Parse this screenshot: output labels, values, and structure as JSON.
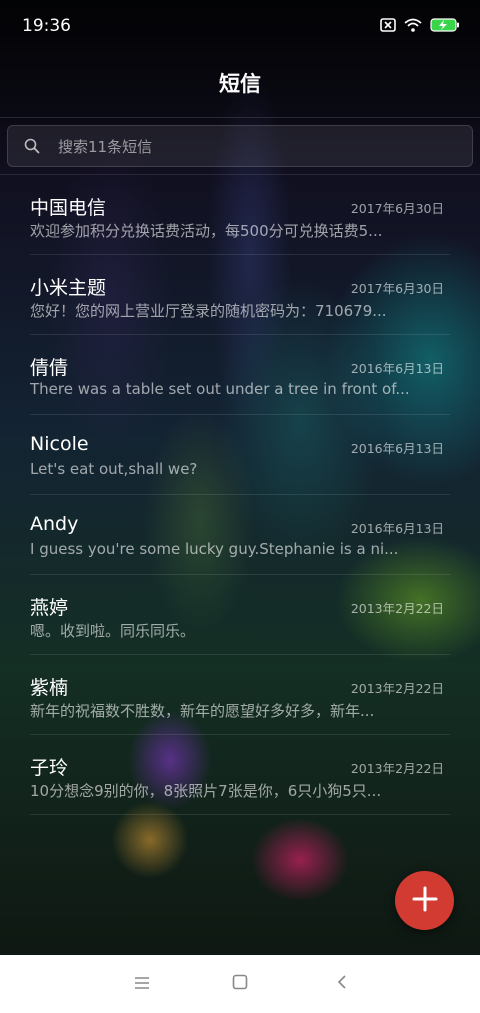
{
  "status": {
    "time": "19:36",
    "icons": [
      "sim-off-icon",
      "wifi-icon",
      "battery-charging-icon"
    ]
  },
  "header": {
    "title": "短信"
  },
  "search": {
    "placeholder": "搜索11条短信"
  },
  "conversations": [
    {
      "name": "中国电信",
      "date": "2017年6月30日",
      "preview": "欢迎参加积分兑换话费活动，每500分可兑换话费5..."
    },
    {
      "name": "小米主题",
      "date": "2017年6月30日",
      "preview": "您好！您的网上营业厅登录的随机密码为：710679..."
    },
    {
      "name": "倩倩",
      "date": "2016年6月13日",
      "preview": "There was a table set out under a tree in front of..."
    },
    {
      "name": "Nicole",
      "date": "2016年6月13日",
      "preview": "Let's eat out,shall we?"
    },
    {
      "name": "Andy",
      "date": "2016年6月13日",
      "preview": "I guess you're some lucky guy.Stephanie is a ni..."
    },
    {
      "name": "燕婷",
      "date": "2013年2月22日",
      "preview": "嗯。收到啦。同乐同乐。"
    },
    {
      "name": "紫楠",
      "date": "2013年2月22日",
      "preview": "新年的祝福数不胜数，新年的愿望好多好多，新年..."
    },
    {
      "name": "子玲",
      "date": "2013年2月22日",
      "preview": "10分想念9别的你，8张照片7张是你，6只小狗5只..."
    }
  ],
  "fab": {
    "icon": "plus-icon",
    "color": "#d23b32"
  },
  "navbar": {
    "buttons": [
      "menu-icon",
      "home-icon",
      "back-icon"
    ]
  }
}
